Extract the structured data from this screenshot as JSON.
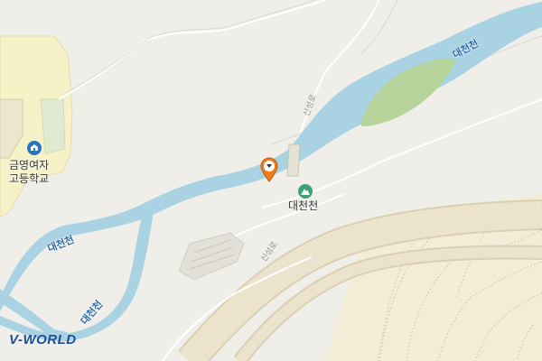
{
  "map": {
    "logo": "V-WORLD",
    "labels": {
      "river_right": "대천천",
      "river_left": "대천천",
      "river_bottom": "대천천",
      "road_upper": "신성로",
      "road_lower": "신성로",
      "school_line1": "금영여자",
      "school_line2": "고등학교",
      "mountain": "대천천"
    },
    "icons": {
      "school": "school-icon",
      "mountain": "mountain-icon",
      "marker": "location-marker-icon"
    },
    "colors": {
      "background": "#efeee9",
      "river": "#a9d2e3",
      "river_label": "#2b6aa8",
      "park": "#b5d39a",
      "school_area": "#f6f2c8",
      "highway": "#e6dcc0",
      "hillshade": "#f3ecd6",
      "contour": "#c9bf9d",
      "marker": "#ef7d1a",
      "mountain_icon": "#3aa17a",
      "school_icon": "#2a74c2"
    }
  }
}
